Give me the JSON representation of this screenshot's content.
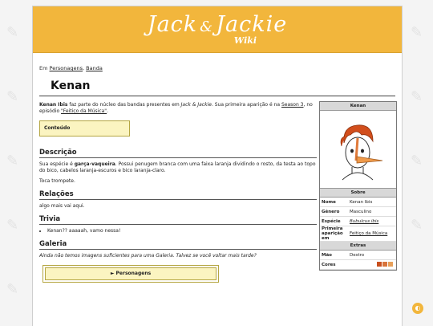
{
  "logo": {
    "main": "Jack",
    "amp": "&",
    "second": "Jackie",
    "sub": "Wiki"
  },
  "breadcrumb": {
    "prefix": "Em",
    "cat1": "Personagens",
    "sep": ",",
    "cat2": "Banda"
  },
  "page_title": "Kenan",
  "intro": {
    "name": "Kenan Ibis",
    "text1": " faz parte do núcleo das bandas presentes em ",
    "work": "Jack & Jackie",
    "text2": ". Sua primeira aparição é na ",
    "season": "Season 3",
    "text3": ", no episódio ",
    "episode": "\"Feitiço da Música\"",
    "text4": "."
  },
  "toc_label": "Conteúdo",
  "sections": {
    "descricao": "Descrição",
    "desc_p1_a": "Sua espécie é ",
    "desc_p1_b": "garça-vaqueira",
    "desc_p1_c": ". Possui penugem branca com uma faixa laranja dividindo o rosto, da testa ao topo do bico, cabelos laranja-escuros e bico laranja-claro.",
    "desc_p2": "Toca trompete.",
    "relacoes": "Relações",
    "rel_text": "algo mais vai aqui.",
    "trivia": "Trivia",
    "trivia_item": "Kenan?? aaaaah, vamo nessa!",
    "galeria": "Galeria",
    "gal_text": "Ainda não temos imagens suficientes para uma Galeria. Talvez se você voltar mais tarde?",
    "nav_label": "► Personagens"
  },
  "infobox": {
    "title": "Kenan",
    "sobre": "Sobre",
    "rows": [
      {
        "k": "Nome",
        "v": "Kenan Ibis"
      },
      {
        "k": "Gênero",
        "v": "Masculino"
      },
      {
        "k": "Espécie",
        "v": "Bubulcus ibis"
      },
      {
        "k": "Primeira aparição em",
        "v": "Feitiço da Música"
      }
    ],
    "extras": "Extras",
    "mao_k": "Mão",
    "mao_v": "Destro",
    "cores_k": "Cores",
    "colors": [
      "#c9501e",
      "#d8743b",
      "#e8a05a"
    ]
  },
  "colors": {
    "banner": "#f2b63c",
    "toc_bg": "#fbf4c1"
  }
}
